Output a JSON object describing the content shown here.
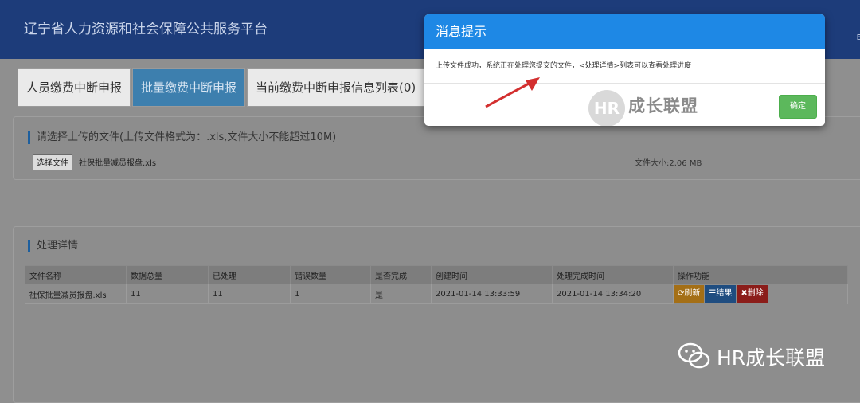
{
  "header": {
    "title": "辽宁省人力资源和社会保障公共服务平台",
    "corner": "E"
  },
  "tabs": [
    {
      "label": "人员缴费中断申报"
    },
    {
      "label": "批量缴费中断申报"
    },
    {
      "label": "当前缴费中断申报信息列表(0)"
    }
  ],
  "upload": {
    "title": "请选择上传的文件(上传文件格式为：.xls,文件大小不能超过10M)",
    "choose_button": "选择文件",
    "file_name": "社保批量减员报盘.xls",
    "file_size": "文件大小:2.06 MB"
  },
  "detail": {
    "title": "处理详情",
    "columns": [
      "文件名称",
      "数据总量",
      "已处理",
      "错误数量",
      "是否完成",
      "创建时间",
      "处理完成时间",
      "操作功能"
    ],
    "rows": [
      [
        "社保批量减员报盘.xls",
        "11",
        "11",
        "1",
        "是",
        "2021-01-14 13:33:59",
        "2021-01-14 13:34:20"
      ]
    ],
    "actions": {
      "refresh": "刷新",
      "result": "结果",
      "delete": "删除"
    }
  },
  "modal": {
    "title": "消息提示",
    "message": "上传文件成功，系统正在处理您提交的文件，<处理详情>列表可以查看处理进度",
    "confirm": "确定"
  },
  "watermark": {
    "logo": "HR",
    "text": "成长联盟",
    "brand": "HR成长联盟"
  }
}
